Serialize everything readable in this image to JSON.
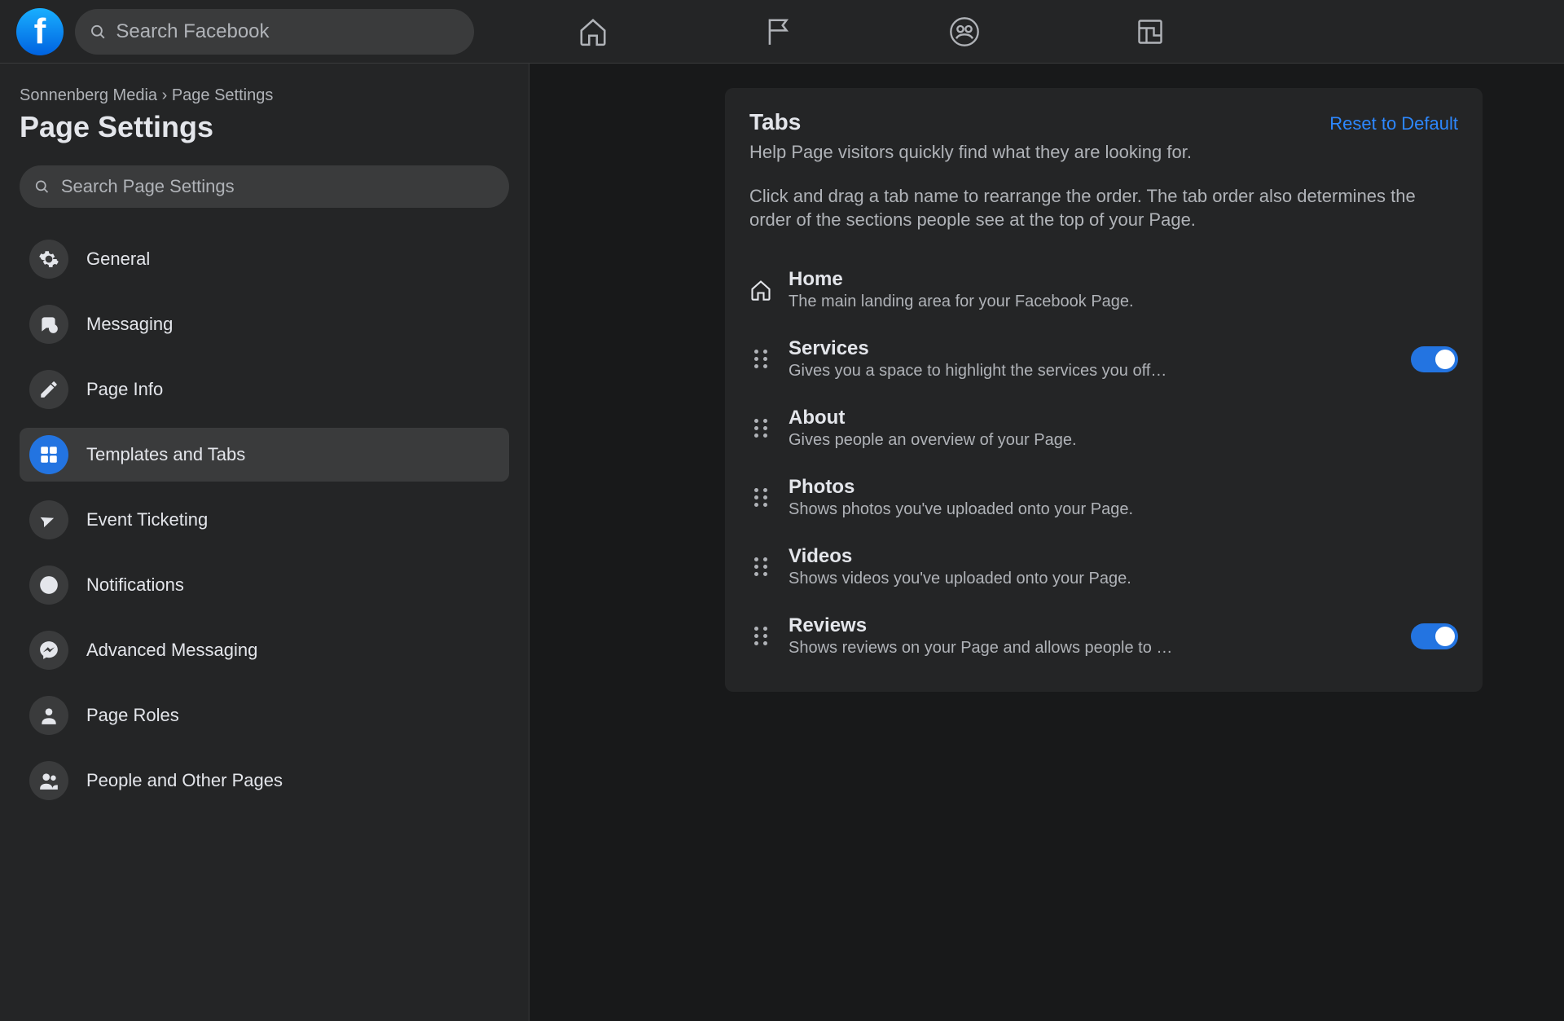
{
  "topbar": {
    "search_placeholder": "Search Facebook"
  },
  "breadcrumb": {
    "page": "Sonnenberg Media",
    "sep": "›",
    "section": "Page Settings"
  },
  "page_title": "Page Settings",
  "sidebar_search_placeholder": "Search Page Settings",
  "menu": [
    {
      "label": "General",
      "icon": "gear"
    },
    {
      "label": "Messaging",
      "icon": "comments"
    },
    {
      "label": "Page Info",
      "icon": "pencil"
    },
    {
      "label": "Templates and Tabs",
      "icon": "grid",
      "active": true
    },
    {
      "label": "Event Ticketing",
      "icon": "ticket"
    },
    {
      "label": "Notifications",
      "icon": "globe"
    },
    {
      "label": "Advanced Messaging",
      "icon": "messenger"
    },
    {
      "label": "Page Roles",
      "icon": "person"
    },
    {
      "label": "People and Other Pages",
      "icon": "people"
    }
  ],
  "panel": {
    "title": "Tabs",
    "reset": "Reset to Default",
    "subtitle": "Help Page visitors quickly find what they are looking for.",
    "description": "Click and drag a tab name to rearrange the order. The tab order also determines the order of the sections people see at the top of your Page."
  },
  "tabs": [
    {
      "title": "Home",
      "desc": "The main landing area for your Facebook Page.",
      "handle": "home",
      "toggle": false
    },
    {
      "title": "Services",
      "desc": "Gives you a space to highlight the services you off…",
      "handle": "drag",
      "toggle": true
    },
    {
      "title": "About",
      "desc": "Gives people an overview of your Page.",
      "handle": "drag",
      "toggle": false
    },
    {
      "title": "Photos",
      "desc": "Shows photos you've uploaded onto your Page.",
      "handle": "drag",
      "toggle": false
    },
    {
      "title": "Videos",
      "desc": "Shows videos you've uploaded onto your Page.",
      "handle": "drag",
      "toggle": false
    },
    {
      "title": "Reviews",
      "desc": "Shows reviews on your Page and allows people to …",
      "handle": "drag",
      "toggle": true
    }
  ]
}
